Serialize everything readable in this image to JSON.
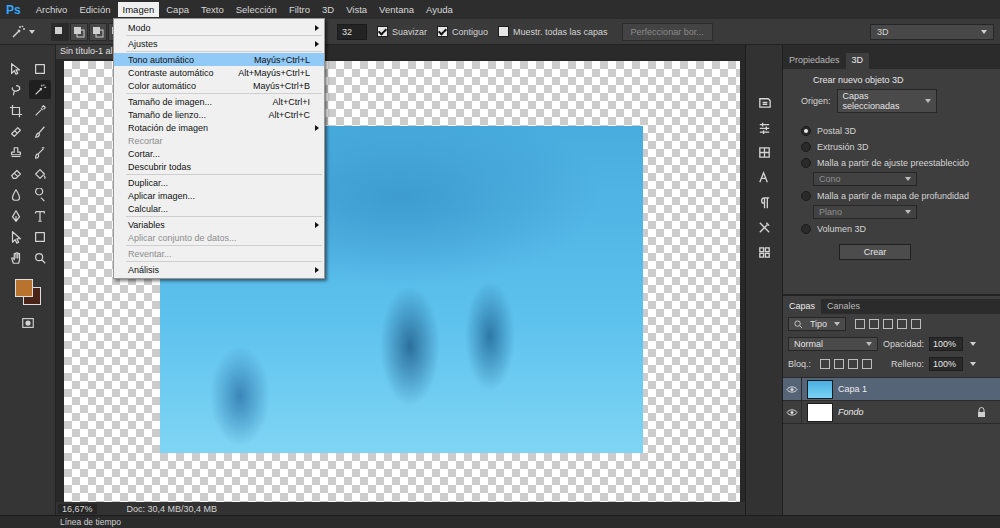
{
  "app": {
    "logo": "Ps"
  },
  "menubar": [
    {
      "label": "Archivo",
      "selected": false
    },
    {
      "label": "Edición",
      "selected": false
    },
    {
      "label": "Imagen",
      "selected": true
    },
    {
      "label": "Capa",
      "selected": false
    },
    {
      "label": "Texto",
      "selected": false
    },
    {
      "label": "Selección",
      "selected": false
    },
    {
      "label": "Filtro",
      "selected": false
    },
    {
      "label": "3D",
      "selected": false
    },
    {
      "label": "Vista",
      "selected": false
    },
    {
      "label": "Ventana",
      "selected": false
    },
    {
      "label": "Ayuda",
      "selected": false
    }
  ],
  "options_bar": {
    "selection_modes": [
      {
        "selected": true
      },
      {
        "selected": false
      },
      {
        "selected": false
      },
      {
        "selected": false
      }
    ],
    "tolerance": "32",
    "checkboxes": [
      {
        "label": "Suavizar",
        "checked": true
      },
      {
        "label": "Contiguo",
        "checked": true
      },
      {
        "label": "Muestr. todas las capas",
        "checked": false
      }
    ],
    "refine_button": {
      "label": "Perfeccionar bor...",
      "disabled": true
    },
    "workspace": "3D"
  },
  "toolbar": {
    "tools": [
      {
        "selected": false
      },
      {
        "selected": false
      },
      {
        "selected": false
      },
      {
        "selected": true
      },
      {
        "selected": false
      },
      {
        "selected": false
      },
      {
        "selected": false
      },
      {
        "selected": false
      },
      {
        "selected": false
      },
      {
        "selected": false
      },
      {
        "selected": false
      },
      {
        "selected": false
      },
      {
        "selected": false
      },
      {
        "selected": false
      },
      {
        "selected": false
      },
      {
        "selected": false
      },
      {
        "selected": false
      },
      {
        "selected": false
      },
      {
        "selected": false
      },
      {
        "selected": false
      }
    ],
    "foreground_color": "#b8732f",
    "background_color": "#4a2418"
  },
  "document": {
    "tab": "Sin título-1 al",
    "zoom": "16,67%",
    "doc_info": "Doc: 30,4 MB/30,4 MB"
  },
  "menu": {
    "items": [
      {
        "kind": "item",
        "label": "Modo",
        "shortcut": "",
        "submenu": true,
        "disabled": false,
        "selected": false
      },
      {
        "kind": "separator"
      },
      {
        "kind": "item",
        "label": "Ajustes",
        "shortcut": "",
        "submenu": true,
        "disabled": false,
        "selected": false
      },
      {
        "kind": "separator"
      },
      {
        "kind": "item",
        "label": "Tono automático",
        "shortcut": "Mayús+Ctrl+L",
        "submenu": false,
        "disabled": false,
        "selected": true
      },
      {
        "kind": "item",
        "label": "Contraste automático",
        "shortcut": "Alt+Mayús+Ctrl+L",
        "submenu": false,
        "disabled": false,
        "selected": false
      },
      {
        "kind": "item",
        "label": "Color automático",
        "shortcut": "Mayús+Ctrl+B",
        "submenu": false,
        "disabled": false,
        "selected": false
      },
      {
        "kind": "separator"
      },
      {
        "kind": "item",
        "label": "Tamaño de imagen...",
        "shortcut": "Alt+Ctrl+I",
        "submenu": false,
        "disabled": false,
        "selected": false
      },
      {
        "kind": "item",
        "label": "Tamaño de lienzo...",
        "shortcut": "Alt+Ctrl+C",
        "submenu": false,
        "disabled": false,
        "selected": false
      },
      {
        "kind": "item",
        "label": "Rotación de imagen",
        "shortcut": "",
        "submenu": true,
        "disabled": false,
        "selected": false
      },
      {
        "kind": "item",
        "label": "Recortar",
        "shortcut": "",
        "submenu": false,
        "disabled": true,
        "selected": false
      },
      {
        "kind": "item",
        "label": "Cortar...",
        "shortcut": "",
        "submenu": false,
        "disabled": false,
        "selected": false
      },
      {
        "kind": "item",
        "label": "Descubrir todas",
        "shortcut": "",
        "submenu": false,
        "disabled": false,
        "selected": false
      },
      {
        "kind": "separator"
      },
      {
        "kind": "item",
        "label": "Duplicar...",
        "shortcut": "",
        "submenu": false,
        "disabled": false,
        "selected": false
      },
      {
        "kind": "item",
        "label": "Aplicar imagen...",
        "shortcut": "",
        "submenu": false,
        "disabled": false,
        "selected": false
      },
      {
        "kind": "item",
        "label": "Calcular...",
        "shortcut": "",
        "submenu": false,
        "disabled": false,
        "selected": false
      },
      {
        "kind": "separator"
      },
      {
        "kind": "item",
        "label": "Variables",
        "shortcut": "",
        "submenu": true,
        "disabled": false,
        "selected": false
      },
      {
        "kind": "item",
        "label": "Aplicar conjunto de datos...",
        "shortcut": "",
        "submenu": false,
        "disabled": true,
        "selected": false
      },
      {
        "kind": "separator"
      },
      {
        "kind": "item",
        "label": "Reventar...",
        "shortcut": "",
        "submenu": false,
        "disabled": true,
        "selected": false
      },
      {
        "kind": "separator"
      },
      {
        "kind": "item",
        "label": "Análisis",
        "shortcut": "",
        "submenu": true,
        "disabled": false,
        "selected": false
      }
    ]
  },
  "properties_panel": {
    "tabs": [
      {
        "label": "Propiedades",
        "selected": false
      },
      {
        "label": "3D",
        "selected": true
      }
    ],
    "heading": "Crear nuevo objeto 3D",
    "source_label": "Origen:",
    "source_value": "Capas seleccionadas",
    "options": [
      {
        "kind": "radio",
        "label": "Postal 3D",
        "selected": true,
        "disabled": false
      },
      {
        "kind": "radio",
        "label": "Extrusión 3D",
        "selected": false,
        "disabled": false
      },
      {
        "kind": "radio",
        "label": "Malla a partir de ajuste preestablecido",
        "selected": false,
        "disabled": false
      },
      {
        "kind": "dropdown",
        "label": "Cono",
        "selected": false,
        "disabled": true
      },
      {
        "kind": "radio",
        "label": "Malla a partir de mapa de profundidad",
        "selected": false,
        "disabled": false
      },
      {
        "kind": "dropdown",
        "label": "Plano",
        "selected": false,
        "disabled": true
      },
      {
        "kind": "radio",
        "label": "Volumen 3D",
        "selected": false,
        "disabled": false
      }
    ],
    "button": "Crear"
  },
  "layers_panel": {
    "tabs": [
      {
        "label": "Capas",
        "selected": true
      },
      {
        "label": "Canales",
        "selected": false
      }
    ],
    "filter": "Tipo",
    "blend_mode": "Normal",
    "opacity_label": "Opacidad:",
    "opacity": "100%",
    "lock_label": "Bloq.:",
    "fill_label": "Relleno:",
    "fill": "100%",
    "layers": [
      {
        "name": "Capa 1",
        "selected": true,
        "visible": true,
        "locked": false,
        "kind": "photo"
      },
      {
        "name": "Fondo",
        "selected": false,
        "visible": true,
        "locked": true,
        "kind": "white"
      }
    ]
  },
  "timeline": {
    "label": "Línea de tiempo"
  }
}
